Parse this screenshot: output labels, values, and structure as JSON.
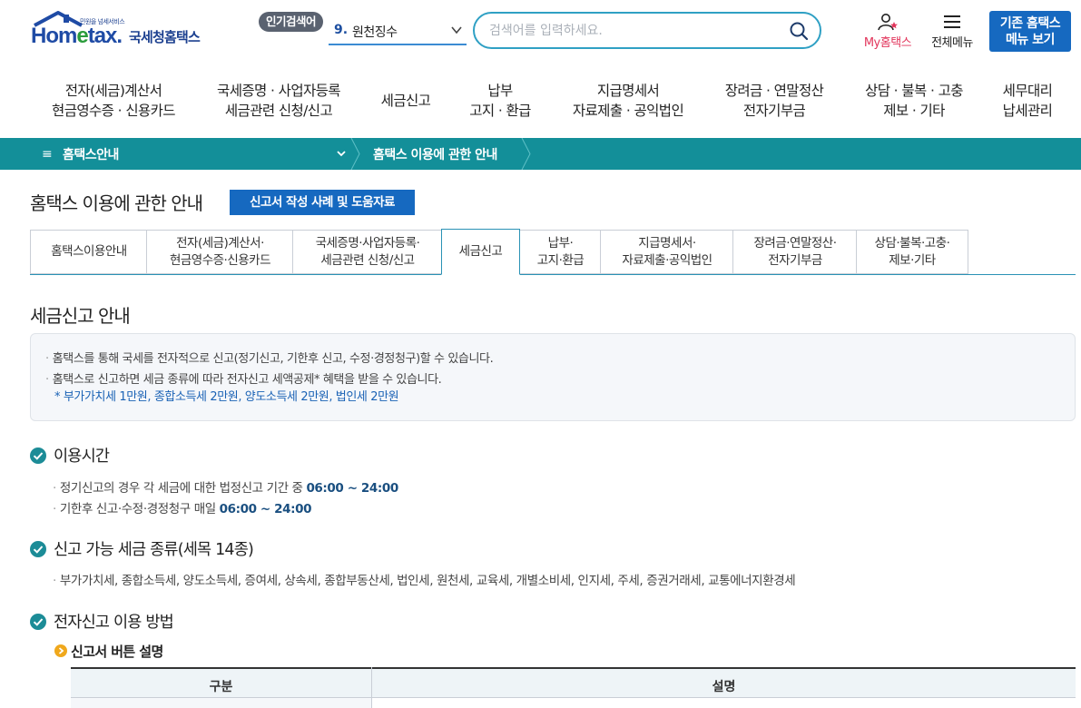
{
  "header": {
    "logo_small": "민원을 넘세서비스",
    "logo_main_a": "Hom",
    "logo_main_e": "e",
    "logo_main_b": "tax.",
    "logo_kr": "국세청홈택스",
    "popular_badge": "인기검색어",
    "popular_rank": "9.",
    "popular_word": "원천징수",
    "search_placeholder": "검색어를 입력하세요.",
    "my_hometax": "My홈택스",
    "all_menu": "전체메뉴",
    "old_menu_line1": "기존 홈택스",
    "old_menu_line2": "메뉴 보기"
  },
  "gnb": [
    {
      "l1": "전자(세금)계산서",
      "l2": "현금영수증 · 신용카드"
    },
    {
      "l1": "국세증명 · 사업자등록",
      "l2": "세금관련 신청/신고"
    },
    {
      "l1": "세금신고",
      "l2": ""
    },
    {
      "l1": "납부",
      "l2": "고지 · 환급"
    },
    {
      "l1": "지급명세서",
      "l2": "자료제출 · 공익법인"
    },
    {
      "l1": "장려금 · 연말정산",
      "l2": "전자기부금"
    },
    {
      "l1": "상담 · 불복 · 고충",
      "l2": "제보 · 기타"
    },
    {
      "l1": "세무대리",
      "l2": "납세관리"
    }
  ],
  "location": {
    "menu_icon": "≡",
    "first": "홈택스안내",
    "second": "홈택스 이용에 관한 안내"
  },
  "page": {
    "title": "홈택스 이용에 관한 안내",
    "help_button": "신고서 작성 사례 및 도움자료"
  },
  "tabs": [
    {
      "l1": "홈택스이용안내",
      "l2": ""
    },
    {
      "l1": "전자(세금)계산서·",
      "l2": "현금영수증·신용카드"
    },
    {
      "l1": "국세증명·사업자등록·",
      "l2": "세금관련 신청/신고"
    },
    {
      "l1": "세금신고",
      "l2": ""
    },
    {
      "l1": "납부·",
      "l2": "고지·환급"
    },
    {
      "l1": "지급명세서·",
      "l2": "자료제출·공익법인"
    },
    {
      "l1": "장려금·연말정산·",
      "l2": "전자기부금"
    },
    {
      "l1": "상담·불복·고충·",
      "l2": "제보·기타"
    }
  ],
  "active_tab": "세금신고",
  "section": {
    "title": "세금신고 안내",
    "info": [
      "홈택스를 통해 국세를 전자적으로 신고(정기신고, 기한후 신고, 수정·경정청구)할 수 있습니다.",
      "홈택스로 신고하면 세금 종류에 따라 전자신고 세액공제* 혜택을 받을 수 있습니다."
    ],
    "info_note": "* 부가가치세 1만원, 종합소득세 2만원, 양도소득세 2만원, 법인세 2만원",
    "usage_time": {
      "title": "이용시간",
      "line1_text": "정기신고의 경우 각 세금에 대한 법정신고 기간 중 ",
      "line1_time": "06:00 ~ 24:00",
      "line2_text": "기한후 신고·수정·경정청구 매일 ",
      "line2_time": "06:00 ~ 24:00"
    },
    "tax_types": {
      "title": "신고 가능 세금 종류(세목 14종)",
      "list": "부가가치세, 종합소득세, 양도소득세, 증여세, 상속세, 종합부동산세, 법인세, 원천세, 교육세, 개별소비세, 인지세, 주세, 증권거래세, 교통에너지환경세"
    },
    "method": {
      "title": "전자신고 이용 방법",
      "sub": "신고서 버튼 설명",
      "col1": "구분",
      "col2": "설명"
    }
  },
  "colors": {
    "brand_blue": "#1669c0",
    "teal_bar": "#138f99",
    "check_teal": "#1c8c97",
    "note_blue": "#1a62b5"
  }
}
